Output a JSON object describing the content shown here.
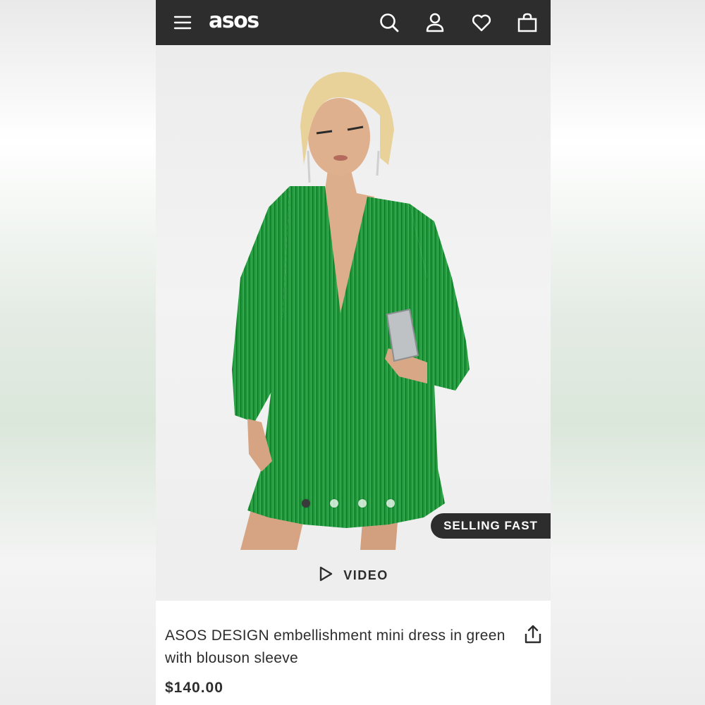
{
  "header": {
    "logo": "asos",
    "icons": [
      "menu-icon",
      "search-icon",
      "account-icon",
      "heart-icon",
      "bag-icon"
    ]
  },
  "product": {
    "image_carousel": {
      "total": 4,
      "active_index": 0
    },
    "badge": "SELLING FAST",
    "video_label": "VIDEO",
    "title": "ASOS DESIGN embellishment mini dress in green with blouson sleeve",
    "price": "$140.00"
  },
  "colors": {
    "header_bg": "#2d2d2d",
    "dress_green": "#1f9a3a",
    "text": "#2d2d2d"
  }
}
